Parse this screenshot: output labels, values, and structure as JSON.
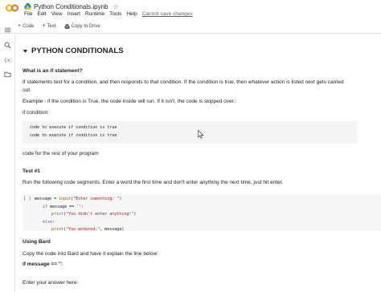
{
  "header": {
    "title": "Python Conditionals.ipynb",
    "menu": [
      "File",
      "Edit",
      "View",
      "Insert",
      "Runtime",
      "Tools",
      "Help"
    ],
    "unsaved": "Cannot save changes"
  },
  "toolbar": {
    "code_label": "Code",
    "text_label": "Text",
    "copy_label": "Copy to Drive"
  },
  "content": {
    "heading": "PYTHON CONDITIONALS",
    "q1": "What is an if statement?",
    "p1_line1": "If statements test for a condition, and then responds to that condition. If the condition is true, then whatever action is listed next gets carried",
    "p1_line2": "out.",
    "p2": "Example - if the condition is True, the code inside will run. If it isn't, the code is skipped over.:",
    "p3": "if condition:",
    "code_line1": "code to execute if condition is true",
    "code_line2": "code to execute if condition is true",
    "p4": "code for the rest of your program",
    "test1": "Test #1",
    "p5": "Run the following code segments. Enter a word the first time and don't enter anything the next time, just hit enter.",
    "cell_bracket": "[ ]",
    "using_bard": "Using Bard",
    "p6": "Copy the code into Bard and have it explain the line below:",
    "p7": "if message == '':",
    "p8": "Enter your answer here:"
  },
  "cell": {
    "l1_var": "message",
    "l1_eq": " = ",
    "l1_fn": "input",
    "l1_open": "(",
    "l1_str": "\"Enter something: \"",
    "l1_close": ")",
    "l2_kw": "if",
    "l2_rest": " message == ",
    "l2_str": "'':",
    "l3_fn": "print",
    "l3_open": "(",
    "l3_str": "\"You didn't enter anything!\"",
    "l3_close": ")",
    "l4_kw": "else:",
    "l5_fn": "print",
    "l5_open": "(",
    "l5_str": "\"You entered:\"",
    "l5_rest": ", message)"
  },
  "icons": {
    "logo": "colab-logo-icon",
    "drive": "drive-icon",
    "star": "star-icon",
    "rail": [
      "menu-icon",
      "search-icon",
      "code-variables-icon",
      "folder-icon"
    ]
  },
  "colors": {
    "logo_orange": "#F9AB00",
    "logo_dark": "#E8710A",
    "code_bg": "#f4f4f4",
    "string": "#a31515",
    "keyword": "#7b30d0"
  }
}
